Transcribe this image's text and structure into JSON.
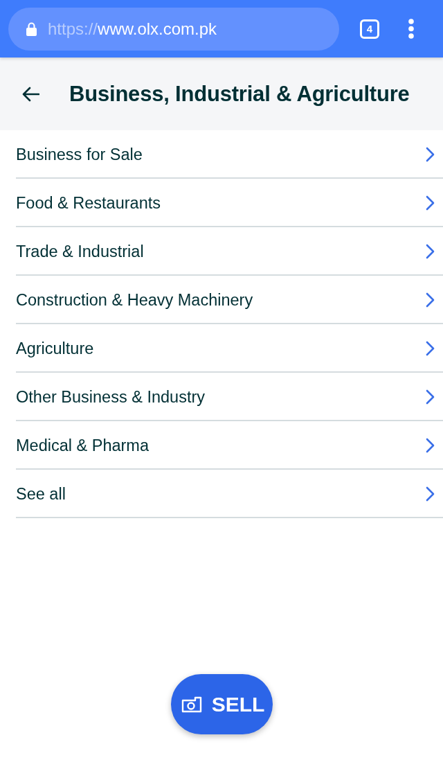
{
  "browser_bar": {
    "url_scheme": "https://",
    "url_host": "www.olx.com.pk",
    "tab_count": "4"
  },
  "header": {
    "title": "Business, Industrial & Agriculture"
  },
  "categories": [
    {
      "label": "Business for Sale"
    },
    {
      "label": "Food & Restaurants"
    },
    {
      "label": "Trade & Industrial"
    },
    {
      "label": "Construction & Heavy Machinery"
    },
    {
      "label": "Agriculture"
    },
    {
      "label": "Other Business & Industry"
    },
    {
      "label": "Medical & Pharma"
    },
    {
      "label": "See all"
    }
  ],
  "sell_button": {
    "label": "SELL"
  }
}
